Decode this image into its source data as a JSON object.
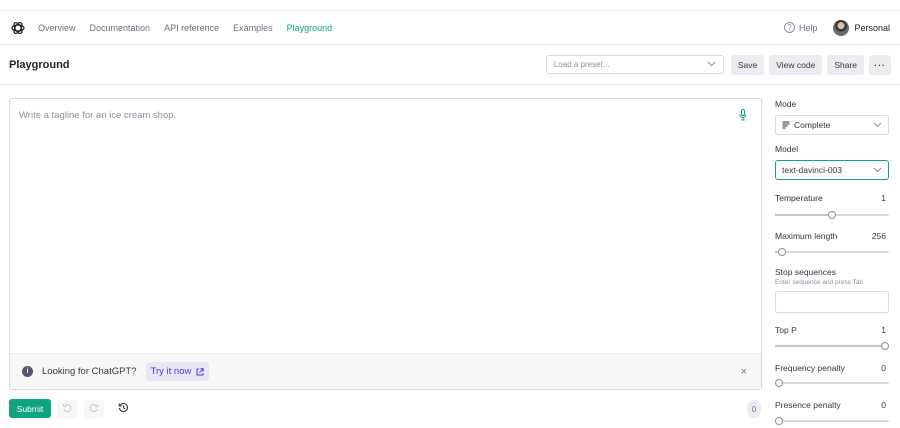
{
  "nav": {
    "links": [
      "Overview",
      "Documentation",
      "API reference",
      "Examples",
      "Playground"
    ],
    "help": "Help",
    "user": "Personal"
  },
  "toolbar": {
    "title": "Playground",
    "preset_placeholder": "Load a preset...",
    "save": "Save",
    "view_code": "View code",
    "share": "Share",
    "more": "···"
  },
  "editor": {
    "placeholder": "Write a tagline for an ice cream shop.",
    "banner_text": "Looking for ChatGPT?",
    "banner_link": "Try it now",
    "close": "×"
  },
  "bottom": {
    "submit": "Submit",
    "token_count": "0"
  },
  "settings": {
    "mode_label": "Mode",
    "mode_value": "Complete",
    "model_label": "Model",
    "model_value": "text-davinci-003",
    "temperature_label": "Temperature",
    "temperature_value": "1",
    "temperature_fraction": 0.5,
    "max_length_label": "Maximum length",
    "max_length_value": "256",
    "max_length_fraction": 0.06,
    "stop_label": "Stop sequences",
    "stop_hint": "Enter sequence and press Tab",
    "top_p_label": "Top P",
    "top_p_value": "1",
    "top_p_fraction": 1.0,
    "freq_label": "Frequency penalty",
    "freq_value": "0",
    "freq_fraction": 0.0,
    "presence_label": "Presence penalty",
    "presence_value": "0",
    "presence_fraction": 0.0
  },
  "colors": {
    "accent": "#10a37f",
    "link": "#5436da"
  }
}
